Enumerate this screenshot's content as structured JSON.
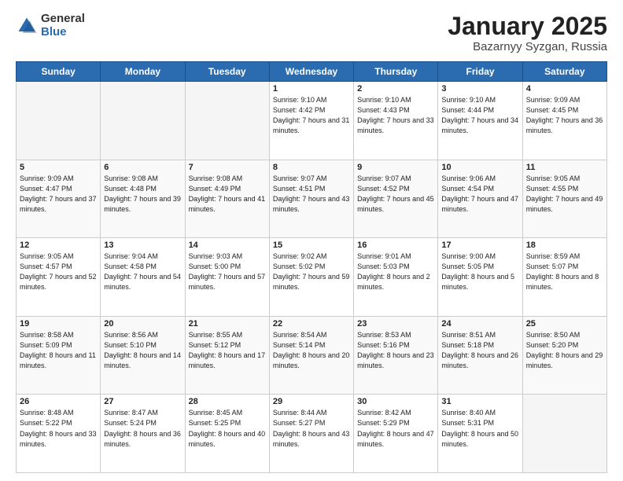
{
  "header": {
    "logo_general": "General",
    "logo_blue": "Blue",
    "month_title": "January 2025",
    "location": "Bazarnyy Syzgan, Russia"
  },
  "weekdays": [
    "Sunday",
    "Monday",
    "Tuesday",
    "Wednesday",
    "Thursday",
    "Friday",
    "Saturday"
  ],
  "weeks": [
    [
      {
        "day": "",
        "info": ""
      },
      {
        "day": "",
        "info": ""
      },
      {
        "day": "",
        "info": ""
      },
      {
        "day": "1",
        "info": "Sunrise: 9:10 AM\nSunset: 4:42 PM\nDaylight: 7 hours and 31 minutes."
      },
      {
        "day": "2",
        "info": "Sunrise: 9:10 AM\nSunset: 4:43 PM\nDaylight: 7 hours and 33 minutes."
      },
      {
        "day": "3",
        "info": "Sunrise: 9:10 AM\nSunset: 4:44 PM\nDaylight: 7 hours and 34 minutes."
      },
      {
        "day": "4",
        "info": "Sunrise: 9:09 AM\nSunset: 4:45 PM\nDaylight: 7 hours and 36 minutes."
      }
    ],
    [
      {
        "day": "5",
        "info": "Sunrise: 9:09 AM\nSunset: 4:47 PM\nDaylight: 7 hours and 37 minutes."
      },
      {
        "day": "6",
        "info": "Sunrise: 9:08 AM\nSunset: 4:48 PM\nDaylight: 7 hours and 39 minutes."
      },
      {
        "day": "7",
        "info": "Sunrise: 9:08 AM\nSunset: 4:49 PM\nDaylight: 7 hours and 41 minutes."
      },
      {
        "day": "8",
        "info": "Sunrise: 9:07 AM\nSunset: 4:51 PM\nDaylight: 7 hours and 43 minutes."
      },
      {
        "day": "9",
        "info": "Sunrise: 9:07 AM\nSunset: 4:52 PM\nDaylight: 7 hours and 45 minutes."
      },
      {
        "day": "10",
        "info": "Sunrise: 9:06 AM\nSunset: 4:54 PM\nDaylight: 7 hours and 47 minutes."
      },
      {
        "day": "11",
        "info": "Sunrise: 9:05 AM\nSunset: 4:55 PM\nDaylight: 7 hours and 49 minutes."
      }
    ],
    [
      {
        "day": "12",
        "info": "Sunrise: 9:05 AM\nSunset: 4:57 PM\nDaylight: 7 hours and 52 minutes."
      },
      {
        "day": "13",
        "info": "Sunrise: 9:04 AM\nSunset: 4:58 PM\nDaylight: 7 hours and 54 minutes."
      },
      {
        "day": "14",
        "info": "Sunrise: 9:03 AM\nSunset: 5:00 PM\nDaylight: 7 hours and 57 minutes."
      },
      {
        "day": "15",
        "info": "Sunrise: 9:02 AM\nSunset: 5:02 PM\nDaylight: 7 hours and 59 minutes."
      },
      {
        "day": "16",
        "info": "Sunrise: 9:01 AM\nSunset: 5:03 PM\nDaylight: 8 hours and 2 minutes."
      },
      {
        "day": "17",
        "info": "Sunrise: 9:00 AM\nSunset: 5:05 PM\nDaylight: 8 hours and 5 minutes."
      },
      {
        "day": "18",
        "info": "Sunrise: 8:59 AM\nSunset: 5:07 PM\nDaylight: 8 hours and 8 minutes."
      }
    ],
    [
      {
        "day": "19",
        "info": "Sunrise: 8:58 AM\nSunset: 5:09 PM\nDaylight: 8 hours and 11 minutes."
      },
      {
        "day": "20",
        "info": "Sunrise: 8:56 AM\nSunset: 5:10 PM\nDaylight: 8 hours and 14 minutes."
      },
      {
        "day": "21",
        "info": "Sunrise: 8:55 AM\nSunset: 5:12 PM\nDaylight: 8 hours and 17 minutes."
      },
      {
        "day": "22",
        "info": "Sunrise: 8:54 AM\nSunset: 5:14 PM\nDaylight: 8 hours and 20 minutes."
      },
      {
        "day": "23",
        "info": "Sunrise: 8:53 AM\nSunset: 5:16 PM\nDaylight: 8 hours and 23 minutes."
      },
      {
        "day": "24",
        "info": "Sunrise: 8:51 AM\nSunset: 5:18 PM\nDaylight: 8 hours and 26 minutes."
      },
      {
        "day": "25",
        "info": "Sunrise: 8:50 AM\nSunset: 5:20 PM\nDaylight: 8 hours and 29 minutes."
      }
    ],
    [
      {
        "day": "26",
        "info": "Sunrise: 8:48 AM\nSunset: 5:22 PM\nDaylight: 8 hours and 33 minutes."
      },
      {
        "day": "27",
        "info": "Sunrise: 8:47 AM\nSunset: 5:24 PM\nDaylight: 8 hours and 36 minutes."
      },
      {
        "day": "28",
        "info": "Sunrise: 8:45 AM\nSunset: 5:25 PM\nDaylight: 8 hours and 40 minutes."
      },
      {
        "day": "29",
        "info": "Sunrise: 8:44 AM\nSunset: 5:27 PM\nDaylight: 8 hours and 43 minutes."
      },
      {
        "day": "30",
        "info": "Sunrise: 8:42 AM\nSunset: 5:29 PM\nDaylight: 8 hours and 47 minutes."
      },
      {
        "day": "31",
        "info": "Sunrise: 8:40 AM\nSunset: 5:31 PM\nDaylight: 8 hours and 50 minutes."
      },
      {
        "day": "",
        "info": ""
      }
    ]
  ]
}
